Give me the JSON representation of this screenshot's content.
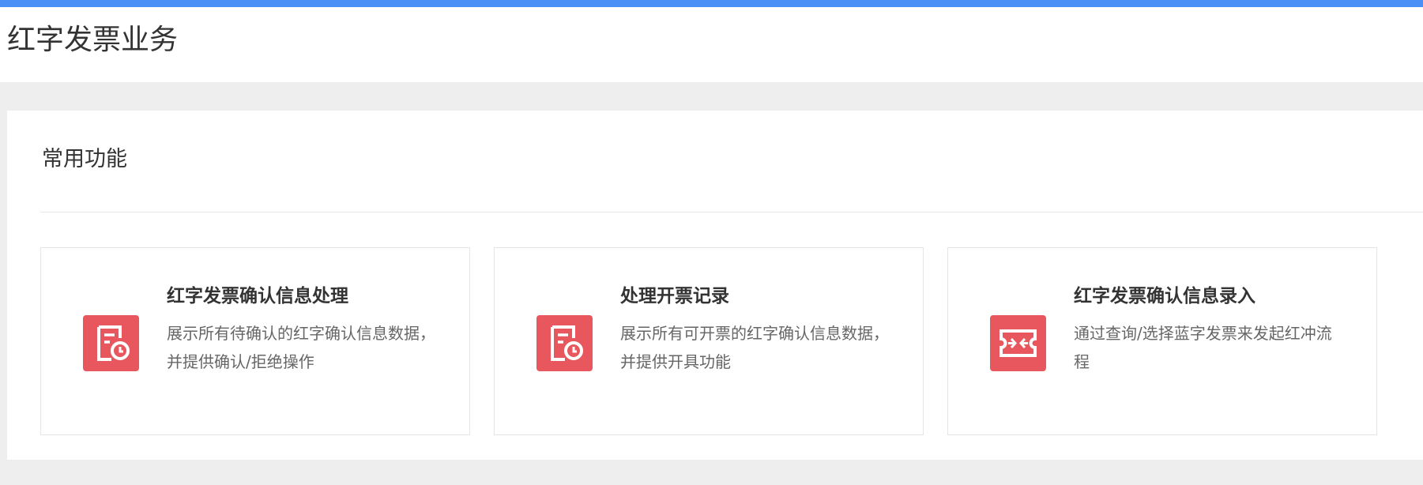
{
  "page": {
    "title": "红字发票业务"
  },
  "section": {
    "title": "常用功能"
  },
  "cards": [
    {
      "icon": "document-clock-icon",
      "title": "红字发票确认信息处理",
      "description": "展示所有待确认的红字确认信息数据，并提供确认/拒绝操作"
    },
    {
      "icon": "document-clock-icon",
      "title": "处理开票记录",
      "description": "展示所有可开票的红字确认信息数据，并提供开具功能"
    },
    {
      "icon": "ticket-arrows-icon",
      "title": "红字发票确认信息录入",
      "description": "通过查询/选择蓝字发票来发起红冲流程"
    }
  ],
  "colors": {
    "accent_bar": "#4a8ff5",
    "icon_background": "#e8565e",
    "page_background": "#eeeeef"
  }
}
